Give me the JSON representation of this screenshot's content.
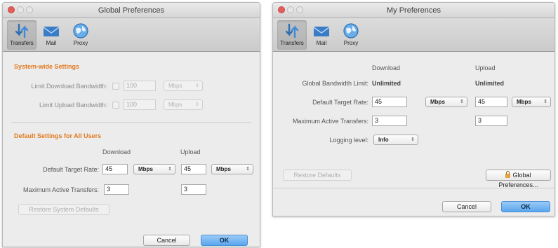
{
  "global_window": {
    "title": "Global Preferences",
    "toolbar": [
      {
        "label": "Transfers",
        "icon": "transfers-icon",
        "active": true
      },
      {
        "label": "Mail",
        "icon": "mail-icon"
      },
      {
        "label": "Proxy",
        "icon": "proxy-icon"
      }
    ],
    "system_section": {
      "title": "System-wide Settings",
      "limit_download_label": "Limit Download Bandwidth:",
      "limit_download_value": "100",
      "limit_download_unit": "Mbps",
      "limit_upload_label": "Limit Upload Bandwidth:",
      "limit_upload_value": "100",
      "limit_upload_unit": "Mbps"
    },
    "default_section": {
      "title": "Default Settings for All Users",
      "col_download": "Download",
      "col_upload": "Upload",
      "target_rate_label": "Default Target Rate:",
      "download_rate": "45",
      "download_unit": "Mbps",
      "upload_rate": "45",
      "upload_unit": "Mbps",
      "max_transfers_label": "Maximum Active Transfers:",
      "download_max": "3",
      "upload_max": "3",
      "restore_button": "Restore System Defaults"
    },
    "cancel_button": "Cancel",
    "ok_button": "OK"
  },
  "my_window": {
    "title": "My Preferences",
    "toolbar": [
      {
        "label": "Transfers",
        "icon": "transfers-icon",
        "active": true
      },
      {
        "label": "Mail",
        "icon": "mail-icon"
      },
      {
        "label": "Proxy",
        "icon": "proxy-icon"
      }
    ],
    "col_download": "Download",
    "col_upload": "Upload",
    "bandwidth_limit_label": "Global Bandwidth Limit:",
    "download_limit": "Unlimited",
    "upload_limit": "Unlimited",
    "target_rate_label": "Default Target Rate:",
    "download_rate": "45",
    "download_unit": "Mbps",
    "upload_rate": "45",
    "upload_unit": "Mbps",
    "max_transfers_label": "Maximum Active Transfers:",
    "download_max": "3",
    "upload_max": "3",
    "logging_label": "Logging level:",
    "logging_value": "Info",
    "restore_button": "Restore Defaults",
    "global_prefs_button": "Global Preferences...",
    "cancel_button": "Cancel",
    "ok_button": "OK"
  },
  "colors": {
    "section_title": "#e2791d",
    "primary_button": "#5aa6ee",
    "close_light": "#e35d5b"
  }
}
